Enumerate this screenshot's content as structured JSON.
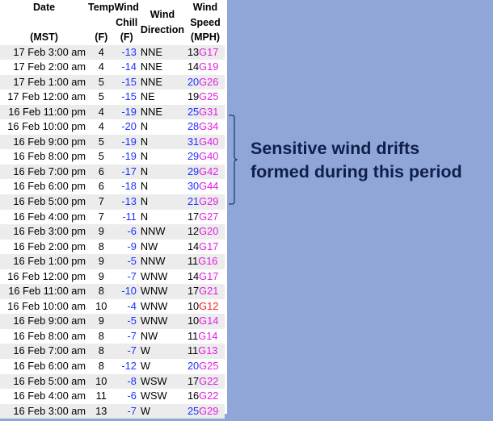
{
  "headers": {
    "date": [
      "Date",
      "",
      "(MST)"
    ],
    "temp": [
      "Temp",
      "",
      "(F)"
    ],
    "chill": [
      "Wind",
      "Chill",
      "(F)"
    ],
    "dir": [
      "Wind",
      "Direction"
    ],
    "speed": [
      "Wind",
      "Speed",
      "(MPH)"
    ]
  },
  "colors": {
    "blue": "#1a31ff",
    "magenta": "#e01ee0",
    "red": "#ff1a1a",
    "annotation": "#0f1f4a",
    "background": "#8fa6d6"
  },
  "rows": [
    {
      "date": "17 Feb 3:00 am",
      "temp": "4",
      "chill": "-13",
      "dir": "NNE",
      "speed": "13",
      "speed_color": "blk",
      "gust": "G17",
      "gust_color": "mag"
    },
    {
      "date": "17 Feb 2:00 am",
      "temp": "4",
      "chill": "-14",
      "dir": "NNE",
      "speed": "14",
      "speed_color": "blk",
      "gust": "G19",
      "gust_color": "mag"
    },
    {
      "date": "17 Feb 1:00 am",
      "temp": "5",
      "chill": "-15",
      "dir": "NNE",
      "speed": "20",
      "speed_color": "blue",
      "gust": "G26",
      "gust_color": "mag"
    },
    {
      "date": "17 Feb 12:00 am",
      "temp": "5",
      "chill": "-15",
      "dir": "NE",
      "speed": "19",
      "speed_color": "blk",
      "gust": "G25",
      "gust_color": "mag"
    },
    {
      "date": "16 Feb 11:00 pm",
      "temp": "4",
      "chill": "-19",
      "dir": "NNE",
      "speed": "25",
      "speed_color": "blue",
      "gust": "G31",
      "gust_color": "mag"
    },
    {
      "date": "16 Feb 10:00 pm",
      "temp": "4",
      "chill": "-20",
      "dir": "N",
      "speed": "28",
      "speed_color": "blue",
      "gust": "G34",
      "gust_color": "mag"
    },
    {
      "date": "16 Feb 9:00 pm",
      "temp": "5",
      "chill": "-19",
      "dir": "N",
      "speed": "31",
      "speed_color": "blue",
      "gust": "G40",
      "gust_color": "mag"
    },
    {
      "date": "16 Feb 8:00 pm",
      "temp": "5",
      "chill": "-19",
      "dir": "N",
      "speed": "29",
      "speed_color": "blue",
      "gust": "G40",
      "gust_color": "mag"
    },
    {
      "date": "16 Feb 7:00 pm",
      "temp": "6",
      "chill": "-17",
      "dir": "N",
      "speed": "29",
      "speed_color": "blue",
      "gust": "G42",
      "gust_color": "mag"
    },
    {
      "date": "16 Feb 6:00 pm",
      "temp": "6",
      "chill": "-18",
      "dir": "N",
      "speed": "30",
      "speed_color": "blue",
      "gust": "G44",
      "gust_color": "mag"
    },
    {
      "date": "16 Feb 5:00 pm",
      "temp": "7",
      "chill": "-13",
      "dir": "N",
      "speed": "21",
      "speed_color": "blue",
      "gust": "G29",
      "gust_color": "mag"
    },
    {
      "date": "16 Feb 4:00 pm",
      "temp": "7",
      "chill": "-11",
      "dir": "N",
      "speed": "17",
      "speed_color": "blk",
      "gust": "G27",
      "gust_color": "mag"
    },
    {
      "date": "16 Feb 3:00 pm",
      "temp": "9",
      "chill": "-6",
      "dir": "NNW",
      "speed": "12",
      "speed_color": "blk",
      "gust": "G20",
      "gust_color": "mag"
    },
    {
      "date": "16 Feb 2:00 pm",
      "temp": "8",
      "chill": "-9",
      "dir": "NW",
      "speed": "14",
      "speed_color": "blk",
      "gust": "G17",
      "gust_color": "mag"
    },
    {
      "date": "16 Feb 1:00 pm",
      "temp": "9",
      "chill": "-5",
      "dir": "NNW",
      "speed": "11",
      "speed_color": "blk",
      "gust": "G16",
      "gust_color": "mag"
    },
    {
      "date": "16 Feb 12:00 pm",
      "temp": "9",
      "chill": "-7",
      "dir": "WNW",
      "speed": "14",
      "speed_color": "blk",
      "gust": "G17",
      "gust_color": "mag"
    },
    {
      "date": "16 Feb 11:00 am",
      "temp": "8",
      "chill": "-10",
      "dir": "WNW",
      "speed": "17",
      "speed_color": "blk",
      "gust": "G21",
      "gust_color": "mag"
    },
    {
      "date": "16 Feb 10:00 am",
      "temp": "10",
      "chill": "-4",
      "dir": "WNW",
      "speed": "10",
      "speed_color": "blk",
      "gust": "G12",
      "gust_color": "red"
    },
    {
      "date": "16 Feb 9:00 am",
      "temp": "9",
      "chill": "-5",
      "dir": "WNW",
      "speed": "10",
      "speed_color": "blk",
      "gust": "G14",
      "gust_color": "mag"
    },
    {
      "date": "16 Feb 8:00 am",
      "temp": "8",
      "chill": "-7",
      "dir": "NW",
      "speed": "11",
      "speed_color": "blk",
      "gust": "G14",
      "gust_color": "mag"
    },
    {
      "date": "16 Feb 7:00 am",
      "temp": "8",
      "chill": "-7",
      "dir": "W",
      "speed": "11",
      "speed_color": "blk",
      "gust": "G13",
      "gust_color": "mag"
    },
    {
      "date": "16 Feb 6:00 am",
      "temp": "8",
      "chill": "-12",
      "dir": "W",
      "speed": "20",
      "speed_color": "blue",
      "gust": "G25",
      "gust_color": "mag"
    },
    {
      "date": "16 Feb 5:00 am",
      "temp": "10",
      "chill": "-8",
      "dir": "WSW",
      "speed": "17",
      "speed_color": "blk",
      "gust": "G22",
      "gust_color": "mag"
    },
    {
      "date": "16 Feb 4:00 am",
      "temp": "11",
      "chill": "-6",
      "dir": "WSW",
      "speed": "16",
      "speed_color": "blk",
      "gust": "G22",
      "gust_color": "mag"
    },
    {
      "date": "16 Feb 3:00 am",
      "temp": "13",
      "chill": "-7",
      "dir": "W",
      "speed": "25",
      "speed_color": "blue",
      "gust": "G29",
      "gust_color": "mag"
    }
  ],
  "annotation": {
    "line1": "Sensitive wind drifts",
    "line2": "formed during this period"
  }
}
